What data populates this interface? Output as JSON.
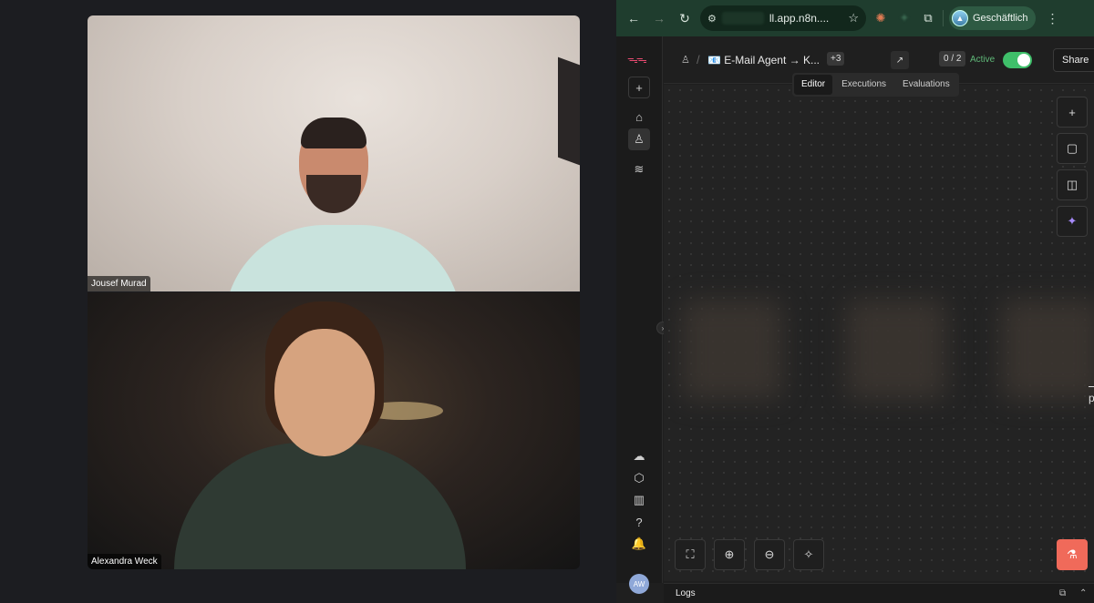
{
  "call": {
    "participants": [
      {
        "name": "Jousef Murad"
      },
      {
        "name": "Alexandra Weck"
      }
    ]
  },
  "browser": {
    "url": "ll.app.n8n....",
    "profile_name": "Geschäftlich",
    "icons": {
      "back": "←",
      "forward": "→",
      "reload": "↻",
      "site_settings": "⚙",
      "star": "☆",
      "ext_claude": "✺",
      "ext_other": "✦",
      "extensions": "⧉",
      "menu": "⋮"
    }
  },
  "n8n": {
    "workflow_title": "📧 E-Mail Agent → K...",
    "tag_count": "+3",
    "counter": "0 / 2",
    "active_label": "Active",
    "active": true,
    "share_label": "Share",
    "tabs": [
      {
        "label": "Editor",
        "active": true
      },
      {
        "label": "Executions",
        "active": false
      },
      {
        "label": "Evaluations",
        "active": false
      }
    ],
    "sidebar_icons": {
      "logo": "ᯓᯓ",
      "add": "+",
      "home": "⌂",
      "personal": "♙",
      "layers": "≋",
      "cloud": "☁",
      "templates": "⬡",
      "insights": "▥",
      "help": "?",
      "notifications": "🔔"
    },
    "user_initials": "AW",
    "canvas_edge_text": "p",
    "logs_label": "Logs",
    "accent_color": "#ea4b71",
    "active_color": "#3fbf6a",
    "test_button_color": "#f06a5a"
  }
}
